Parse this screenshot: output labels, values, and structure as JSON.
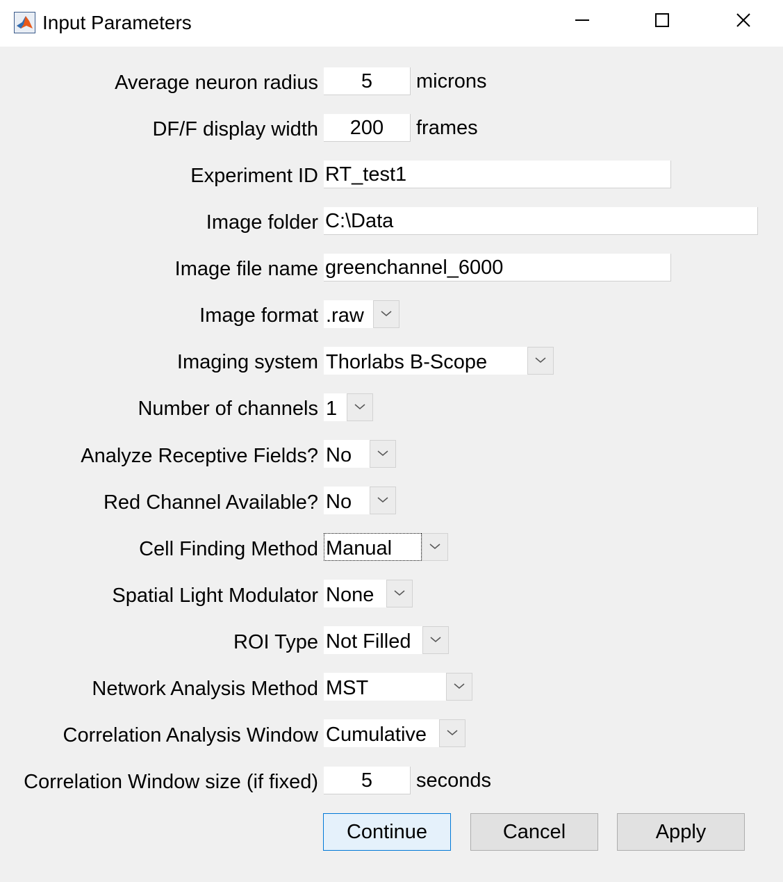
{
  "window": {
    "title": "Input Parameters",
    "controls": {
      "minimize_icon": "minimize-icon",
      "maximize_icon": "maximize-icon",
      "close_icon": "close-icon"
    }
  },
  "fields": {
    "neuron_radius": {
      "label": "Average neuron radius",
      "value": "5",
      "unit": "microns"
    },
    "dff_width": {
      "label": "DF/F display width",
      "value": "200",
      "unit": "frames"
    },
    "experiment_id": {
      "label": "Experiment ID",
      "value": "RT_test1"
    },
    "image_folder": {
      "label": "Image folder",
      "value": "C:\\Data"
    },
    "image_file_name": {
      "label": "Image file name",
      "value": "greenchannel_6000"
    },
    "image_format": {
      "label": "Image format",
      "selected": ".raw"
    },
    "imaging_system": {
      "label": "Imaging system",
      "selected": "Thorlabs B-Scope"
    },
    "num_channels": {
      "label": "Number of channels",
      "selected": "1"
    },
    "receptive_fields": {
      "label": "Analyze Receptive Fields?",
      "selected": "No"
    },
    "red_channel": {
      "label": "Red Channel Available?",
      "selected": "No"
    },
    "cell_finding": {
      "label": "Cell Finding Method",
      "selected": "Manual"
    },
    "slm": {
      "label": "Spatial Light Modulator",
      "selected": "None"
    },
    "roi_type": {
      "label": "ROI Type",
      "selected": "Not Filled"
    },
    "network_analysis": {
      "label": "Network Analysis Method",
      "selected": "MST"
    },
    "correlation_window": {
      "label": "Correlation Analysis Window",
      "selected": "Cumulative"
    },
    "correlation_size": {
      "label": "Correlation Window size (if fixed)",
      "value": "5",
      "unit": "seconds"
    }
  },
  "buttons": {
    "continue": "Continue",
    "cancel": "Cancel",
    "apply": "Apply"
  },
  "colors": {
    "background": "#f0f0f0",
    "primary_border": "#0078d7",
    "primary_fill": "#e5f1fb"
  }
}
